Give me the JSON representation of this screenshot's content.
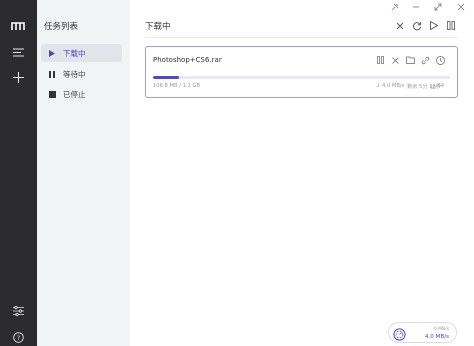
{
  "sidebar": {
    "title": "任务列表",
    "items": [
      {
        "label": "下载中",
        "icon": "play-icon",
        "active": true
      },
      {
        "label": "等待中",
        "icon": "pause-icon",
        "active": false
      },
      {
        "label": "已停止",
        "icon": "stop-icon",
        "active": false
      }
    ]
  },
  "main": {
    "title": "下载中"
  },
  "task": {
    "name": "Photoshop+CS6.rar",
    "size": "106.8 MB / 1.2 GB",
    "progress": 0.087,
    "speed": "↓ 4.0 MB/s",
    "remaining": "剩余 5分 18秒",
    "connections": "64"
  },
  "speed_meter": {
    "up": "0 MB/s",
    "down": "4.0 MB/s"
  },
  "colors": {
    "accent": "#4e46d4",
    "rail": "#2c2c2e",
    "panel": "#f2f3f5"
  }
}
